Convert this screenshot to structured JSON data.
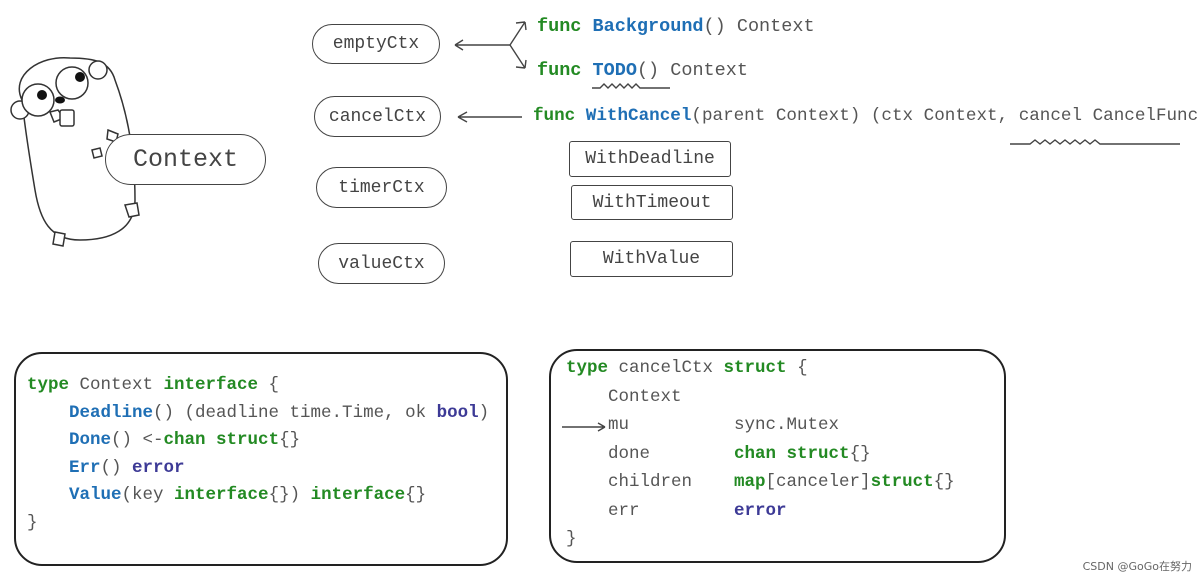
{
  "gopher_label": "Context",
  "types": [
    "emptyCtx",
    "cancelCtx",
    "timerCtx",
    "valueCtx"
  ],
  "constructors": [
    "WithDeadline",
    "WithTimeout",
    "WithValue"
  ],
  "funcs": [
    [
      {
        "t": "func ",
        "c": "kw"
      },
      {
        "t": "Background",
        "c": "fn"
      },
      {
        "t": "() Context",
        "c": "pl"
      }
    ],
    [
      {
        "t": "func ",
        "c": "kw"
      },
      {
        "t": "TODO",
        "c": "fn"
      },
      {
        "t": "() Context",
        "c": "pl"
      }
    ],
    [
      {
        "t": "func ",
        "c": "kw"
      },
      {
        "t": "WithCancel",
        "c": "fn"
      },
      {
        "t": "(parent Context) (ctx Context, cancel CancelFunc)",
        "c": "pl"
      }
    ]
  ],
  "interface_code": [
    [
      {
        "t": "type ",
        "c": "kw"
      },
      {
        "t": "Context ",
        "c": "pl"
      },
      {
        "t": "interface",
        "c": "kw"
      },
      {
        "t": " {",
        "c": "pl"
      }
    ],
    [
      {
        "t": "    ",
        "c": "pl"
      },
      {
        "t": "Deadline",
        "c": "fn"
      },
      {
        "t": "() (deadline time.Time, ok ",
        "c": "pl"
      },
      {
        "t": "bool",
        "c": "ty"
      },
      {
        "t": ")",
        "c": "pl"
      }
    ],
    [
      {
        "t": "    ",
        "c": "pl"
      },
      {
        "t": "Done",
        "c": "fn"
      },
      {
        "t": "() <-",
        "c": "pl"
      },
      {
        "t": "chan struct",
        "c": "kw"
      },
      {
        "t": "{}",
        "c": "pl"
      }
    ],
    [
      {
        "t": "    ",
        "c": "pl"
      },
      {
        "t": "Err",
        "c": "fn"
      },
      {
        "t": "() ",
        "c": "pl"
      },
      {
        "t": "error",
        "c": "ty"
      }
    ],
    [
      {
        "t": "    ",
        "c": "pl"
      },
      {
        "t": "Value",
        "c": "fn"
      },
      {
        "t": "(key ",
        "c": "pl"
      },
      {
        "t": "interface",
        "c": "kw"
      },
      {
        "t": "{}) ",
        "c": "pl"
      },
      {
        "t": "interface",
        "c": "kw"
      },
      {
        "t": "{}",
        "c": "pl"
      }
    ],
    [
      {
        "t": "}",
        "c": "pl"
      }
    ]
  ],
  "struct_code": [
    [
      {
        "t": "type ",
        "c": "kw"
      },
      {
        "t": "cancelCtx ",
        "c": "pl"
      },
      {
        "t": "struct",
        "c": "kw"
      },
      {
        "t": " {",
        "c": "pl"
      }
    ],
    [
      {
        "t": "    Context",
        "c": "pl"
      }
    ],
    [
      {
        "t": "    mu          ",
        "c": "pl"
      },
      {
        "t": "sync.Mutex",
        "c": "pl"
      }
    ],
    [
      {
        "t": "    done        ",
        "c": "pl"
      },
      {
        "t": "chan struct",
        "c": "kw"
      },
      {
        "t": "{}",
        "c": "pl"
      }
    ],
    [
      {
        "t": "    children    ",
        "c": "pl"
      },
      {
        "t": "map",
        "c": "kw"
      },
      {
        "t": "[canceler]",
        "c": "pl"
      },
      {
        "t": "struct",
        "c": "kw"
      },
      {
        "t": "{}",
        "c": "pl"
      }
    ],
    [
      {
        "t": "    err         ",
        "c": "pl"
      },
      {
        "t": "error",
        "c": "ty"
      }
    ],
    [
      {
        "t": "}",
        "c": "pl"
      }
    ]
  ],
  "watermark": "CSDN @GoGo在努力",
  "colors": {
    "keyword": "#238a23",
    "function": "#1f6fb5",
    "builtin_type": "#3d3a96",
    "text": "#555555"
  }
}
